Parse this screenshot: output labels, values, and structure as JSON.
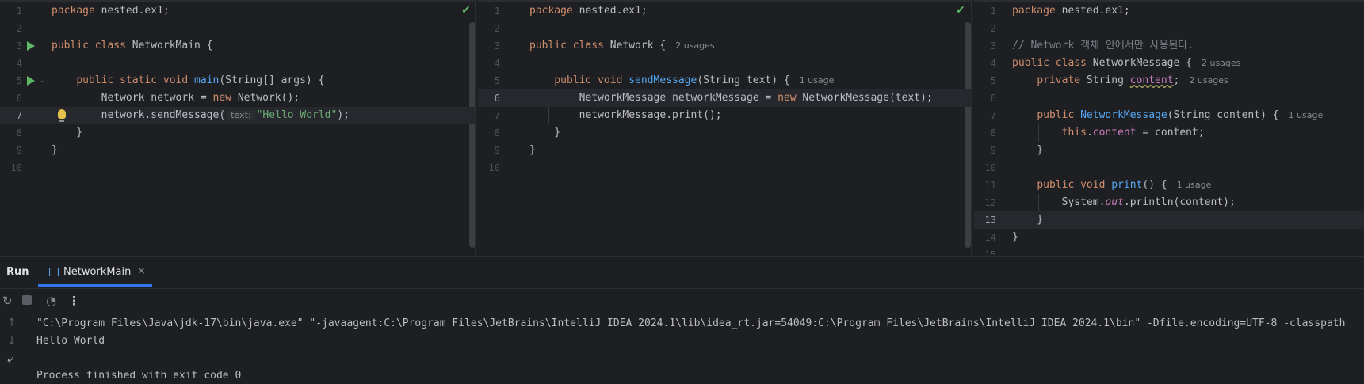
{
  "editors": [
    {
      "file": "NetworkMain",
      "line_numbers": [
        "1",
        "2",
        "3",
        "4",
        "5",
        "6",
        "7",
        "8",
        "9",
        "10"
      ],
      "current_line": "7",
      "code": {
        "l1_kw": "package",
        "l1_rest": " nested.ex1;",
        "l3_kw": "public class",
        "l3_rest": " NetworkMain {",
        "l5_indent": "    ",
        "l5_kw": "public static void",
        "l5_fn": "main",
        "l5_rest": "(String[] args) {",
        "l6_indent": "        ",
        "l6_a": "Network network = ",
        "l6_kw": "new",
        "l6_b": " Network();",
        "l7_indent": "        ",
        "l7_a": "network.sendMessage(",
        "l7_hint": "text:",
        "l7_str": "\"Hello World\"",
        "l7_b": ");",
        "l8": "    }",
        "l9": "}"
      }
    },
    {
      "file": "Network",
      "line_numbers": [
        "1",
        "2",
        "3",
        "4",
        "5",
        "6",
        "7",
        "8",
        "9",
        "10"
      ],
      "current_line": "6",
      "code": {
        "l1_kw": "package",
        "l1_rest": " nested.ex1;",
        "l3_kw": "public class",
        "l3_rest": " Network {",
        "l3_usage": "2 usages",
        "l5_indent": "    ",
        "l5_kw": "public void",
        "l5_fn": "sendMessage",
        "l5_rest": "(String text) {",
        "l5_usage": "1 usage",
        "l6_indent": "        ",
        "l6_a": "NetworkMessage networkMessage = ",
        "l6_kw": "new",
        "l6_b": " NetworkMessage(text);",
        "l7_indent": "        ",
        "l7_a": "networkMessage.print();",
        "l8": "    }",
        "l9": "}"
      }
    },
    {
      "file": "NetworkMessage",
      "line_numbers": [
        "1",
        "2",
        "3",
        "4",
        "5",
        "6",
        "7",
        "8",
        "9",
        "10",
        "11",
        "12",
        "13",
        "14",
        "15"
      ],
      "current_line": "13",
      "code": {
        "l1_kw": "package",
        "l1_rest": " nested.ex1;",
        "l3_cmt": "// Network 객체 안에서만 사용된다.",
        "l4_kw": "public class",
        "l4_rest": " NetworkMessage {",
        "l4_usage": "2 usages",
        "l5_indent": "    ",
        "l5_kw": "private",
        "l5_a": " String ",
        "l5_field": "content",
        "l5_b": ";",
        "l5_usage": "2 usages",
        "l7_indent": "    ",
        "l7_kw": "public",
        "l7_fn": "NetworkMessage",
        "l7_rest": "(String content) {",
        "l7_usage": "1 usage",
        "l8_indent": "        ",
        "l8_kw": "this",
        "l8_dot": ".",
        "l8_field": "content",
        "l8_rest": " = content;",
        "l9": "    }",
        "l11_indent": "    ",
        "l11_kw": "public void",
        "l11_fn": "print",
        "l11_rest": "() {",
        "l11_usage": "1 usage",
        "l12_indent": "        ",
        "l12_a": "System.",
        "l12_static": "out",
        "l12_b": ".println(content);",
        "l13": "    }",
        "l14": "}"
      }
    }
  ],
  "run_panel": {
    "title": "Run",
    "tab_label": "NetworkMain",
    "tab_close": "×",
    "toolbar_icons": [
      "rerun-icon",
      "stop-icon",
      "coverage-icon",
      "more-icon"
    ],
    "side_icons": [
      "scroll-up-icon",
      "scroll-down-icon",
      "soft-wrap-icon"
    ],
    "console_lines": [
      "\"C:\\Program Files\\Java\\jdk-17\\bin\\java.exe\" \"-javaagent:C:\\Program Files\\JetBrains\\IntelliJ IDEA 2024.1\\lib\\idea_rt.jar=54049:C:\\Program Files\\JetBrains\\IntelliJ IDEA 2024.1\\bin\" -Dfile.encoding=UTF-8 -classpath",
      "Hello World",
      "",
      "Process finished with exit code 0"
    ]
  },
  "colors": {
    "background": "#1e1f22",
    "keyword": "#cf8e6d",
    "function": "#56a8f5",
    "string": "#6aab73",
    "field": "#c77dbb",
    "accent": "#3574f0",
    "ok": "#5fb865"
  }
}
